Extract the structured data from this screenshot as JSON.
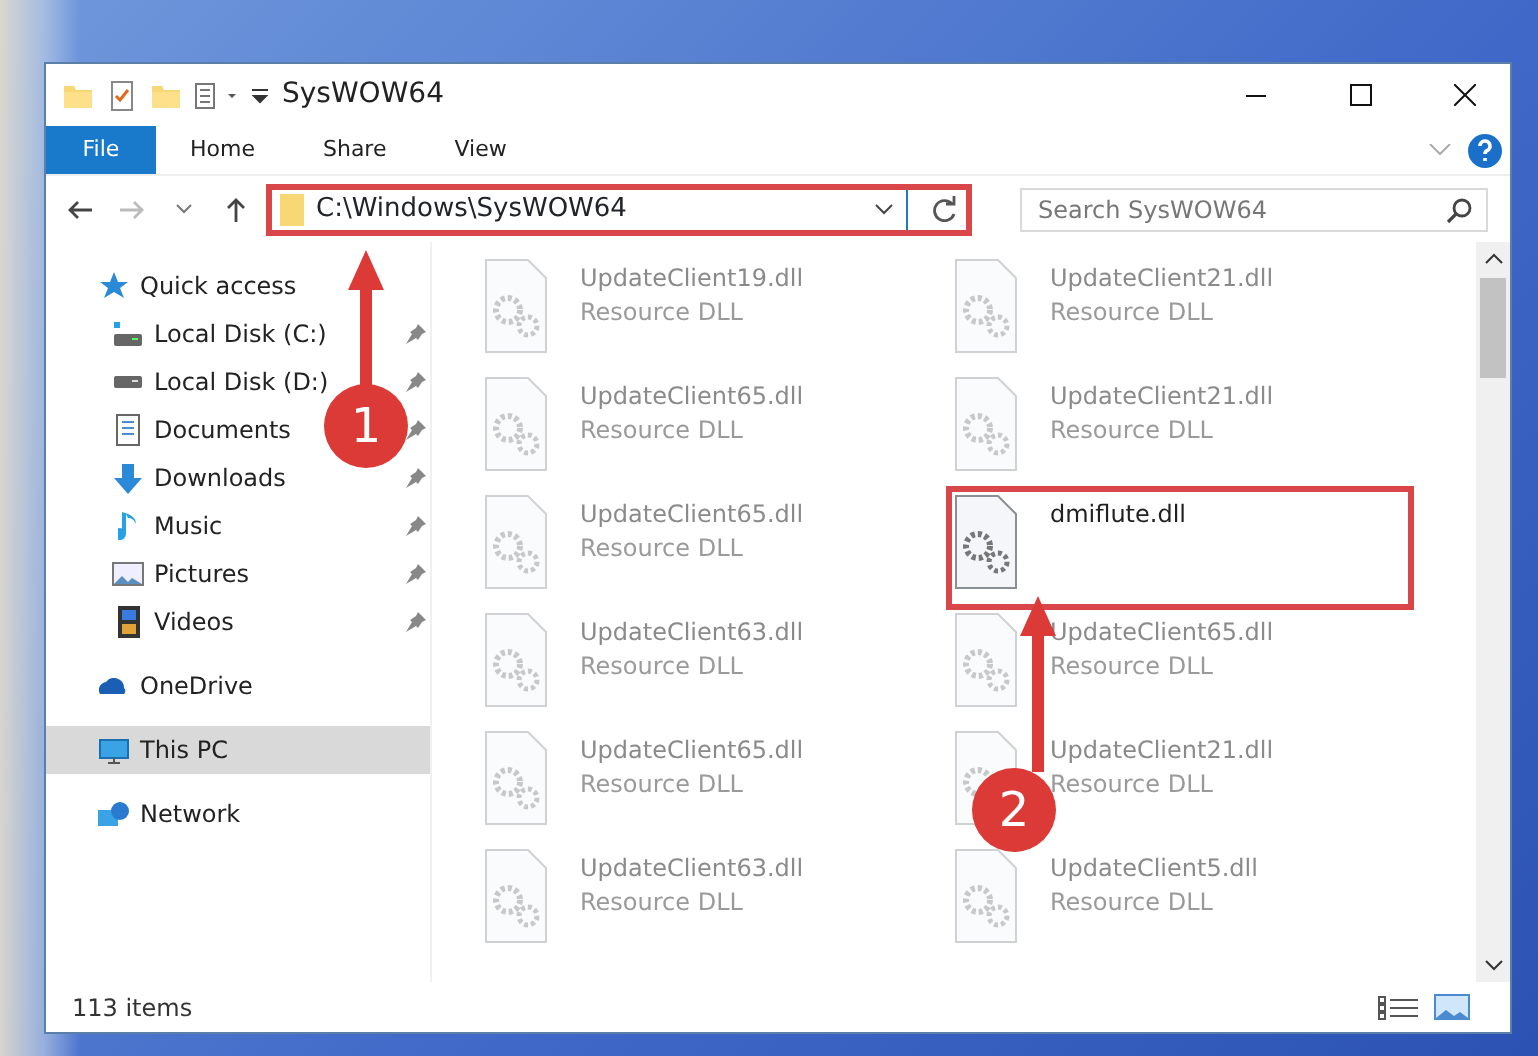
{
  "window": {
    "title": "SysWOW64"
  },
  "ribbon_tabs": [
    {
      "label": "File",
      "kind": "file",
      "selected": false
    },
    {
      "label": "Home",
      "kind": "tab",
      "selected": false
    },
    {
      "label": "Share",
      "kind": "tab",
      "selected": false
    },
    {
      "label": "View",
      "kind": "tab",
      "selected": false
    }
  ],
  "address": {
    "path": "C:\\Windows\\SysWOW64",
    "highlighted": true
  },
  "search": {
    "placeholder": "Search SysWOW64"
  },
  "sidebar": {
    "items": [
      {
        "label": "Quick access",
        "selected": false,
        "children": [
          {
            "label": "Local Disk (C:)",
            "pinned": true
          },
          {
            "label": "Local Disk (D:)",
            "pinned": true
          },
          {
            "label": "Documents",
            "pinned": true
          },
          {
            "label": "Downloads",
            "pinned": true
          },
          {
            "label": "Music",
            "pinned": true
          },
          {
            "label": "Pictures",
            "pinned": true
          },
          {
            "label": "Videos",
            "pinned": true
          }
        ]
      },
      {
        "label": "OneDrive",
        "selected": false
      },
      {
        "label": "This PC",
        "selected": true
      },
      {
        "label": "Network",
        "selected": false
      }
    ]
  },
  "files": [
    {
      "name": "UpdateClient19.dll",
      "type": "Resource DLL",
      "blurred": true,
      "highlighted": false
    },
    {
      "name": "UpdateClient21.dll",
      "type": "Resource DLL",
      "blurred": true,
      "highlighted": false
    },
    {
      "name": "UpdateClient65.dll",
      "type": "Resource DLL",
      "blurred": true,
      "highlighted": false
    },
    {
      "name": "UpdateClient21.dll",
      "type": "Resource DLL",
      "blurred": true,
      "highlighted": false
    },
    {
      "name": "UpdateClient65.dll",
      "type": "Resource DLL",
      "blurred": true,
      "highlighted": false
    },
    {
      "name": "dmiflute.dll",
      "blurred": false,
      "highlighted": true
    },
    {
      "name": "UpdateClient63.dll",
      "type": "Resource DLL",
      "blurred": true,
      "highlighted": false
    },
    {
      "name": "UpdateClient65.dll",
      "type": "Resource DLL",
      "blurred": true,
      "highlighted": false
    },
    {
      "name": "UpdateClient65.dll",
      "type": "Resource DLL",
      "blurred": true,
      "highlighted": false
    },
    {
      "name": "UpdateClient21.dll",
      "type": "Resource DLL",
      "blurred": true,
      "highlighted": false
    },
    {
      "name": "UpdateClient63.dll",
      "type": "Resource DLL",
      "blurred": true,
      "highlighted": false
    },
    {
      "name": "UpdateClient5.dll",
      "type": "Resource DLL",
      "blurred": true,
      "highlighted": false
    }
  ],
  "status_bar": {
    "item_count": "113 items"
  },
  "annotations": [
    {
      "number": "1"
    },
    {
      "number": "2"
    }
  ]
}
